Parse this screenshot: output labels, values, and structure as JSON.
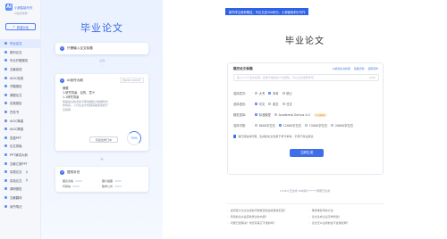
{
  "brand": {
    "name": "小狼智能写作",
    "sub": "AI论文写作"
  },
  "sidebar": {
    "new_btn": "新建对话",
    "items": [
      {
        "label": "毕业论文",
        "active": true
      },
      {
        "label": "期刊论文"
      },
      {
        "label": "毕业开题报告"
      },
      {
        "label": "文献综述"
      },
      {
        "label": "AIGC检测"
      },
      {
        "label": "开题报告"
      },
      {
        "label": "课程论文"
      },
      {
        "label": "实践报告"
      },
      {
        "label": "任务书"
      },
      {
        "label": "AIGC降重"
      },
      {
        "label": "AIGC降重"
      },
      {
        "label": "查重PPT"
      },
      {
        "label": "论文排版"
      },
      {
        "label": "PPT演讲大纲"
      },
      {
        "label": "文献汇报PPT"
      },
      {
        "label": "实践论文",
        "tag": "新"
      },
      {
        "label": "实验论文",
        "tag": "新"
      },
      {
        "label": "调研报告"
      },
      {
        "label": "文献翻译"
      },
      {
        "label": "读书笔记"
      }
    ]
  },
  "panel": {
    "title": "毕业论文",
    "step1": {
      "num": "1",
      "label": "只需输入论文标题"
    },
    "arrow1": "立刻",
    "step2": {
      "num": "2",
      "label": "AI创作大纲",
      "chip": "约6000-30000字",
      "lines": [
        "摘要",
        "1.研究背景、目的、意义",
        "1.1研究背景"
      ],
      "desc": "随着信息技术的不断发展和大数据时代的到来，人们生活方式越来越多依赖于互联网",
      "pill": "阶段性修订中",
      "progress": "70%"
    },
    "arrow2": "+",
    "step3": {
      "num": "3",
      "label": "提效补充",
      "stats": [
        "图表表格",
        "图片插图",
        "代码块",
        "数学公式"
      ]
    }
  },
  "main": {
    "notice": "新同学注册即赠送，写论文送500积分，小狼使用积分写作",
    "title": "毕业论文",
    "card": {
      "heading": "题交论文标题",
      "links": [
        "AI优化论文标题",
        "查看示例",
        "如何写作"
      ],
      "placeholder": "输入1-5个论文标题，如果不能提供个论题稿，可以点这里帮你写",
      "counter": "0/80",
      "level": {
        "label": "选择层次:",
        "options": [
          "大专",
          "本科",
          "硕士"
        ],
        "selected": "本科"
      },
      "language": {
        "label": "选择语言:",
        "options": [
          "中文",
          "英文",
          "日文"
        ],
        "selected": "中文"
      },
      "model": {
        "label": "模型选择:",
        "options": [
          "标准模型",
          "Academia Genius 4.0"
        ],
        "selected": "标准模型",
        "badge": "专业级模型"
      },
      "words": {
        "label": "选择字数:",
        "options": [
          "8000字左右",
          "12000字左右",
          "15000字左右",
          "20000字左右"
        ],
        "selected": "12000字左右"
      },
      "agree": "我已阅读并同意，生成的论文仅用于学习参考，不用于商业用途",
      "submit": "立即生成"
    },
    "below": "1138人已生成 188用户******刚刚已生成",
    "faq": [
      "如何区分论文生成的字数能否和最终需求匹配？",
      "降低重复率的方法",
      "所用的论文是否收录过的内容？",
      "论文生成之后怎样修改？",
      "问题已经解决？你还有其它不懂的吗？",
      "论文怎么生成的会不会重复啊？"
    ]
  },
  "colors": {
    "accent": "#3f6fe8",
    "notice_bg": "#2f62e6"
  }
}
